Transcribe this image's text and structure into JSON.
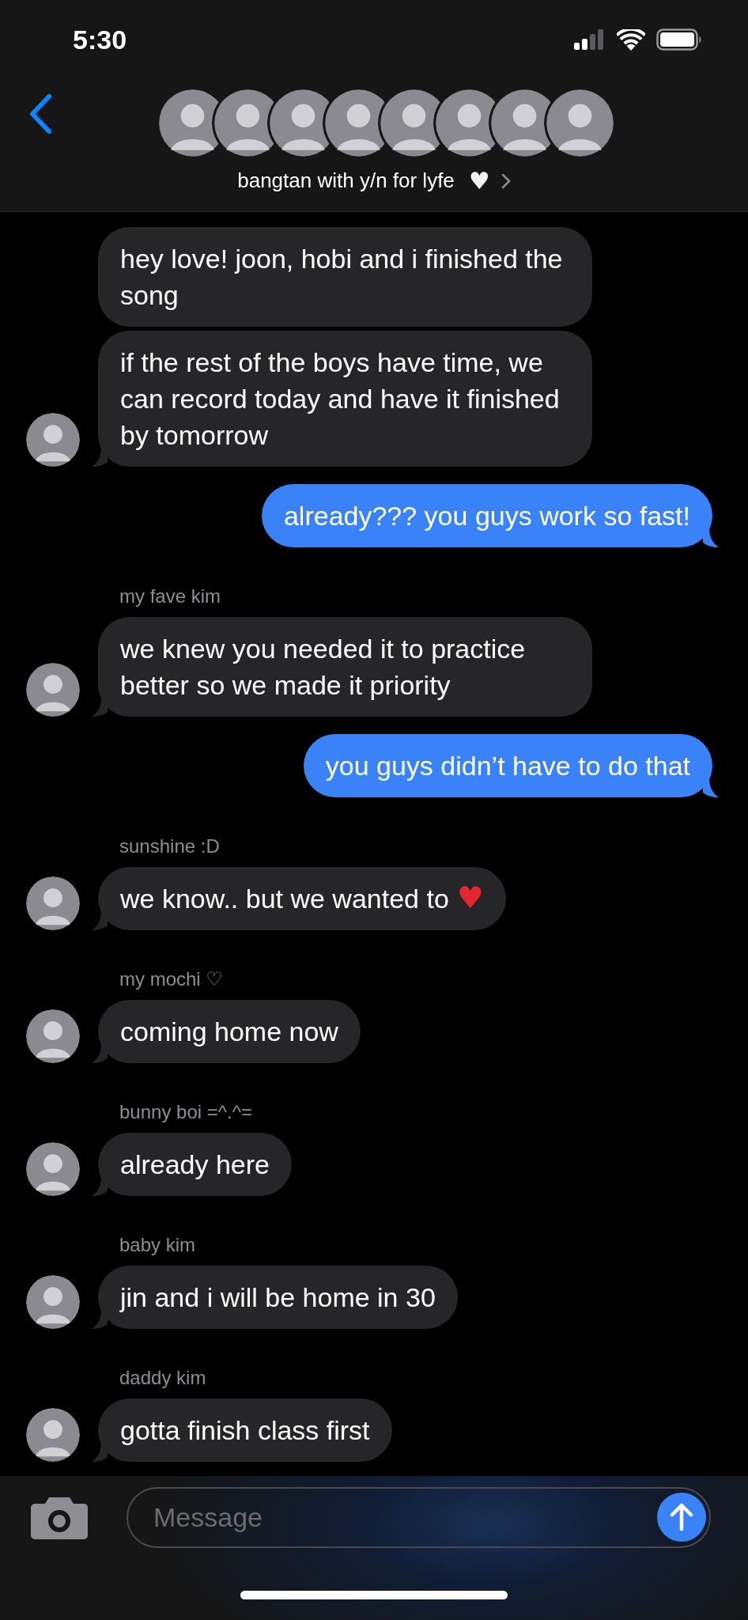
{
  "status_bar": {
    "time": "5:30"
  },
  "header": {
    "members": [
      {
        "kind": "avatar"
      },
      {
        "kind": "avatar"
      },
      {
        "kind": "avatar"
      },
      {
        "kind": "avatar"
      },
      {
        "kind": "avatar"
      },
      {
        "kind": "avatar"
      },
      {
        "kind": "avatar"
      },
      {
        "kind": "avatar"
      }
    ],
    "title": "bangtan with y/n for lyfe",
    "title_emoji": "♥"
  },
  "messages": [
    {
      "kind": "incoming",
      "text": "hey love! joon, hobi and i finished the song",
      "avatar": false
    },
    {
      "kind": "incoming",
      "text": "if the rest of the boys have time, we can record today and have it finished by tomorrow",
      "avatar": true
    },
    {
      "kind": "outgoing",
      "text": "already??? you guys work so fast!"
    },
    {
      "kind": "incoming",
      "sender": "my fave kim",
      "text": "we knew you needed it to practice better so we made it priority",
      "avatar": true
    },
    {
      "kind": "outgoing",
      "text": "you guys didn’t have to do that"
    },
    {
      "kind": "incoming",
      "sender": "sunshine :D",
      "text": "we know.. but we wanted to",
      "emoji": "♥",
      "avatar": true
    },
    {
      "kind": "incoming",
      "sender": "my mochi ♡",
      "text": "coming home now",
      "avatar": true
    },
    {
      "kind": "incoming",
      "sender": "bunny boi =^.^=",
      "text": "already here",
      "avatar": true
    },
    {
      "kind": "incoming",
      "sender": "baby kim",
      "text": "jin and i will be home in 30",
      "avatar": true
    },
    {
      "kind": "incoming",
      "sender": "daddy kim",
      "text": "gotta finish class first",
      "avatar": true
    }
  ],
  "composer": {
    "placeholder": "Message"
  }
}
